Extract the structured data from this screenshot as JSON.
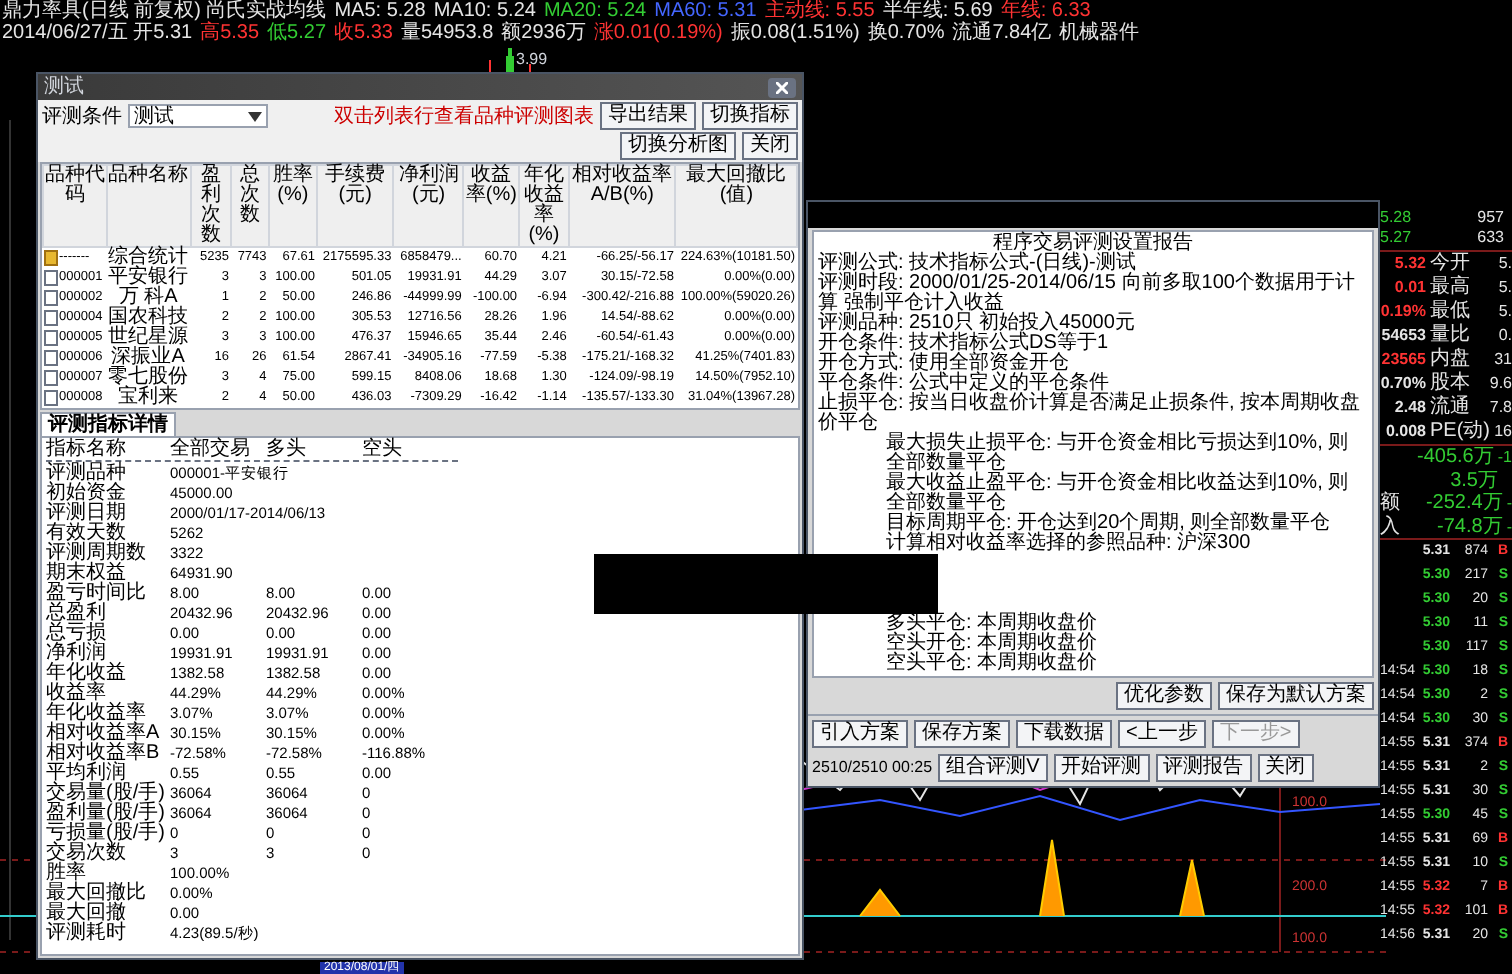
{
  "quote_header": {
    "lines": [
      [
        {
          "text": "鼎力率具(日线 前复权) 尚氏实战均线",
          "color": "#e5e5e5"
        },
        {
          "text": "MA5: 5.28",
          "color": "#e5e5e5"
        },
        {
          "text": "MA10: 5.24",
          "color": "#e5e5e5"
        },
        {
          "text": "MA20: 5.24",
          "color": "#33cc33"
        },
        {
          "text": "MA60: 5.31",
          "color": "#4466ff"
        },
        {
          "text": "主动线: 5.55",
          "color": "#ff3333"
        },
        {
          "text": "半年线: 5.69",
          "color": "#e5e5e5"
        },
        {
          "text": "年线: 6.33",
          "color": "#ff3333"
        }
      ],
      [
        {
          "text": "2014/06/27/五 开5.31",
          "color": "#e5e5e5"
        },
        {
          "text": "高5.35",
          "color": "#ff3333"
        },
        {
          "text": "低5.27",
          "color": "#33cc33"
        },
        {
          "text": "收5.33",
          "color": "#ff3333"
        },
        {
          "text": "量54953.8",
          "color": "#e5e5e5"
        },
        {
          "text": "额2936万",
          "color": "#e5e5e5"
        },
        {
          "text": "涨0.01(0.19%)",
          "color": "#ff3333"
        },
        {
          "text": "振0.08(1.51%)",
          "color": "#e5e5e5"
        },
        {
          "text": "换0.70%",
          "color": "#e5e5e5"
        },
        {
          "text": "流通7.84亿",
          "color": "#e5e5e5"
        },
        {
          "text": "机械器件",
          "color": "#e5e5e5"
        }
      ]
    ]
  },
  "chart": {
    "price_label": "3.99",
    "axis_labels": [
      "100.0",
      "200.0",
      "100.0"
    ],
    "date_label": "2013/08/01/四"
  },
  "results_window": {
    "title": "测试",
    "condition_label": "评测条件",
    "condition_value": "测试",
    "hint": "双击列表行查看品种评测图表",
    "buttons": [
      "导出结果",
      "切换指标",
      "切换分析图",
      "关闭"
    ],
    "table": {
      "columns": [
        "品种代码",
        "品种名称",
        "盈利次数",
        "总次数",
        "胜率(%)",
        "手续费(元)",
        "净利润(元)",
        "收益率(%)",
        "年化收益率(%)",
        "相对收益率A/B(%)",
        "最大回撤比(值)"
      ],
      "rows": [
        {
          "kind": "summary",
          "cells": [
            "-------",
            "综合统计",
            "5235",
            "7743",
            "67.61",
            "2175595.33",
            "6858479...",
            "60.70",
            "4.21",
            "-66.25/-56.17",
            "224.63%(10181.50)"
          ]
        },
        {
          "kind": "stock",
          "cells": [
            "000001",
            "平安银行",
            "3",
            "3",
            "100.00",
            "501.05",
            "19931.91",
            "44.29",
            "3.07",
            "30.15/-72.58",
            "0.00%(0.00)"
          ]
        },
        {
          "kind": "stock",
          "cells": [
            "000002",
            "万 科A",
            "1",
            "2",
            "50.00",
            "246.86",
            "-44999.99",
            "-100.00",
            "-6.94",
            "-300.42/-216.88",
            "100.00%(59020.26)"
          ]
        },
        {
          "kind": "stock",
          "cells": [
            "000004",
            "国农科技",
            "2",
            "2",
            "100.00",
            "305.53",
            "12716.56",
            "28.26",
            "1.96",
            "14.54/-88.62",
            "0.00%(0.00)"
          ]
        },
        {
          "kind": "stock",
          "cells": [
            "000005",
            "世纪星源",
            "3",
            "3",
            "100.00",
            "476.37",
            "15946.65",
            "35.44",
            "2.46",
            "-60.54/-61.43",
            "0.00%(0.00)"
          ]
        },
        {
          "kind": "stock",
          "cells": [
            "000006",
            "深振业A",
            "16",
            "26",
            "61.54",
            "2867.41",
            "-34905.16",
            "-77.59",
            "-5.38",
            "-175.21/-168.32",
            "41.25%(7401.83)"
          ]
        },
        {
          "kind": "stock",
          "cells": [
            "000007",
            "零七股份",
            "3",
            "4",
            "75.00",
            "599.15",
            "8408.06",
            "18.68",
            "1.30",
            "-124.09/-98.19",
            "14.50%(7952.10)"
          ]
        },
        {
          "kind": "stock",
          "cells": [
            "000008",
            "宝利来",
            "2",
            "4",
            "50.00",
            "436.03",
            "-7309.29",
            "-16.42",
            "-1.14",
            "-135.57/-133.30",
            "31.04%(13967.28)"
          ]
        }
      ]
    },
    "tabs": [
      {
        "label": "评测指标详情",
        "selected": true
      }
    ],
    "details": {
      "columns": [
        "指标名称",
        "全部交易",
        "多头",
        "空头"
      ],
      "rows": [
        [
          "评测品种",
          "000001-平安银行"
        ],
        [
          "初始资金",
          "45000.00"
        ],
        [
          "评测日期",
          "2000/01/17-2014/06/13"
        ],
        [
          "有效天数",
          "5262"
        ],
        [
          "评测周期数",
          "3322"
        ],
        [
          "期末权益",
          "64931.90"
        ],
        [
          "盈亏时间比",
          "8.00",
          "8.00",
          "0.00"
        ],
        [
          "总盈利",
          "20432.96",
          "20432.96",
          "0.00"
        ],
        [
          "总亏损",
          "0.00",
          "0.00",
          "0.00"
        ],
        [
          "净利润",
          "19931.91",
          "19931.91",
          "0.00"
        ],
        [
          "年化收益",
          "1382.58",
          "1382.58",
          "0.00"
        ],
        [
          "收益率",
          "44.29%",
          "44.29%",
          "0.00%"
        ],
        [
          "年化收益率",
          "3.07%",
          "3.07%",
          "0.00%"
        ],
        [
          "相对收益率A",
          "30.15%",
          "30.15%",
          "0.00%"
        ],
        [
          "相对收益率B",
          "-72.58%",
          "-72.58%",
          "-116.88%"
        ],
        [
          "平均利润",
          "0.55",
          "0.55",
          "0.00"
        ],
        [
          "交易量(股/手)",
          "36064",
          "36064",
          "0"
        ],
        [
          "盈利量(股/手)",
          "36064",
          "36064",
          "0"
        ],
        [
          "亏损量(股/手)",
          "0",
          "0",
          "0"
        ],
        [
          "交易次数",
          "3",
          "3",
          "0"
        ],
        [
          "胜率",
          "100.00%"
        ],
        [
          "最大回撤比",
          "0.00%"
        ],
        [
          "最大回撤",
          "0.00"
        ],
        [
          "评测耗时",
          "4.23(89.5/秒)"
        ]
      ]
    }
  },
  "report_window": {
    "lines": [
      {
        "kind": "title",
        "text": "程序交易评测设置报告"
      },
      {
        "kind": "line",
        "text": "评测公式: 技术指标公式-(日线)-测试"
      },
      {
        "kind": "line",
        "text": "评测时段: 2000/01/25-2014/06/15 向前多取100个数据用于计算 强制平仓计入收益"
      },
      {
        "kind": "line",
        "text": "评测品种: 2510只 初始投入45000元"
      },
      {
        "kind": "line",
        "text": "开仓条件: 技术指标公式DS等于1"
      },
      {
        "kind": "line",
        "text": "开仓方式: 使用全部资金开仓"
      },
      {
        "kind": "line",
        "text": "平仓条件: 公式中定义的平仓条件"
      },
      {
        "kind": "line",
        "text": "止损平仓: 按当日收盘价计算是否满足止损条件, 按本周期收盘价平仓"
      },
      {
        "kind": "sub",
        "text": "最大损失止损平仓: 与开仓资金相比亏损达到10%, 则全部数量平仓"
      },
      {
        "kind": "sub",
        "text": "最大收益止盈平仓: 与开仓资金相比收益达到10%, 则全部数量平仓"
      },
      {
        "kind": "sub",
        "text": "目标周期平仓: 开仓达到20个周期, 则全部数量平仓"
      },
      {
        "kind": "sub",
        "text": "计算相对收益率选择的参照品种: 沪深300"
      },
      {
        "kind": "gap"
      },
      {
        "kind": "sub",
        "text": "多头平仓: 本周期收盘价"
      },
      {
        "kind": "sub",
        "text": "空头开仓: 本周期收盘价"
      },
      {
        "kind": "sub",
        "text": "空头平仓: 本周期收盘价"
      }
    ],
    "side_buttons": [
      "优化参数",
      "保存为默认方案"
    ],
    "buttons": [
      {
        "label": "引入方案",
        "disabled": false
      },
      {
        "label": "保存方案",
        "disabled": false
      },
      {
        "label": "下载数据",
        "disabled": false
      },
      {
        "label": "<上一步",
        "disabled": false
      },
      {
        "label": "下一步>",
        "disabled": true
      }
    ],
    "progress": "2510/2510 00:25",
    "end_buttons": [
      "组合评测V",
      "开始评测",
      "评测报告",
      "关闭"
    ]
  },
  "quote_panel": {
    "orders": [
      {
        "price": "5.28",
        "volume": "957",
        "color": "#33cc33"
      },
      {
        "price": "5.27",
        "volume": "633",
        "color": "#33cc33"
      }
    ],
    "stats": [
      {
        "other_number": "5.32",
        "label": "今开",
        "value": "5.",
        "color": "#ff3333"
      },
      {
        "other_number": "0.01",
        "label": "最高",
        "value": "5.",
        "color": "#ff3333"
      },
      {
        "other_number": "0.19%",
        "label": "最低",
        "value": "5.",
        "color": "#ff3333"
      },
      {
        "other_number": "54653",
        "label": "量比",
        "value": "0.",
        "color": "#e5e5e5"
      },
      {
        "other_number": "23565",
        "label": "内盘",
        "value": "31",
        "color": "#ff3333"
      },
      {
        "other_number": "0.70%",
        "label": "股本",
        "value": "9.6",
        "color": "#e5e5e5"
      },
      {
        "other_number": "2.48",
        "label": "流通",
        "value": "7.8",
        "color": "#e5e5e5"
      },
      {
        "other_number": "0.008",
        "label": "PE(动)",
        "value": "16",
        "color": "#e5e5e5"
      }
    ],
    "flows": [
      {
        "value": "-405.6万",
        "tail": "-1"
      },
      {
        "value": "3.5万"
      },
      {
        "label": "额",
        "value": "-252.4万",
        "tail": "-"
      },
      {
        "label": "入",
        "value": "-74.8万",
        "tail": "-"
      }
    ],
    "ticks": [
      {
        "price": {
          "value": "5.31",
          "color": "#e5e5e5"
        },
        "volume": "874",
        "side": {
          "value": "B",
          "color": "#ff3333"
        }
      },
      {
        "price": {
          "value": "5.30",
          "color": "#33cc33"
        },
        "volume": "217",
        "side": {
          "value": "S",
          "color": "#33cc33"
        }
      },
      {
        "price": {
          "value": "5.30",
          "color": "#33cc33"
        },
        "volume": "20",
        "side": {
          "value": "S",
          "color": "#33cc33"
        }
      },
      {
        "price": {
          "value": "5.30",
          "color": "#33cc33"
        },
        "volume": "11",
        "side": {
          "value": "S",
          "color": "#33cc33"
        }
      },
      {
        "price": {
          "value": "5.30",
          "color": "#33cc33"
        },
        "volume": "117",
        "side": {
          "value": "S",
          "color": "#33cc33"
        }
      },
      {
        "time": "14:54",
        "price": {
          "value": "5.30",
          "color": "#33cc33"
        },
        "volume": "18",
        "side": {
          "value": "S",
          "color": "#33cc33"
        }
      },
      {
        "time": "14:54",
        "price": {
          "value": "5.30",
          "color": "#33cc33"
        },
        "volume": "2",
        "side": {
          "value": "S",
          "color": "#33cc33"
        }
      },
      {
        "time": "14:54",
        "price": {
          "value": "5.30",
          "color": "#33cc33"
        },
        "volume": "30",
        "side": {
          "value": "S",
          "color": "#33cc33"
        }
      },
      {
        "time": "14:55",
        "price": {
          "value": "5.31",
          "color": "#e5e5e5"
        },
        "volume": "374",
        "side": {
          "value": "B",
          "color": "#ff3333"
        }
      },
      {
        "time": "14:55",
        "price": {
          "value": "5.31",
          "color": "#e5e5e5"
        },
        "volume": "2",
        "side": {
          "value": "S",
          "color": "#33cc33"
        }
      },
      {
        "time": "14:55",
        "price": {
          "value": "5.31",
          "color": "#e5e5e5"
        },
        "volume": "30",
        "side": {
          "value": "S",
          "color": "#33cc33"
        }
      },
      {
        "time": "14:55",
        "price": {
          "value": "5.30",
          "color": "#33cc33"
        },
        "volume": "45",
        "side": {
          "value": "S",
          "color": "#33cc33"
        }
      },
      {
        "time": "14:55",
        "price": {
          "value": "5.31",
          "color": "#e5e5e5"
        },
        "volume": "69",
        "side": {
          "value": "B",
          "color": "#ff3333"
        }
      },
      {
        "time": "14:55",
        "price": {
          "value": "5.31",
          "color": "#e5e5e5"
        },
        "volume": "10",
        "side": {
          "value": "S",
          "color": "#33cc33"
        }
      },
      {
        "time": "14:55",
        "price": {
          "value": "5.32",
          "color": "#ff3333"
        },
        "volume": "7",
        "side": {
          "value": "B",
          "color": "#ff3333"
        }
      },
      {
        "time": "14:55",
        "price": {
          "value": "5.32",
          "color": "#ff3333"
        },
        "volume": "101",
        "side": {
          "value": "B",
          "color": "#ff3333"
        }
      },
      {
        "time": "14:56",
        "price": {
          "value": "5.31",
          "color": "#e5e5e5"
        },
        "volume": "20",
        "side": {
          "value": "S",
          "color": "#33cc33"
        }
      }
    ]
  }
}
